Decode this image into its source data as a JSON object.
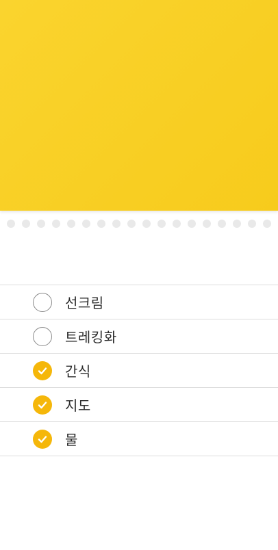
{
  "colors": {
    "header": "#f8cf24",
    "accent": "#f5b70a",
    "divider": "#dcdcdc",
    "perforation_dot": "#e9e9e9"
  },
  "checklist": {
    "items": [
      {
        "label": "선크림",
        "checked": false
      },
      {
        "label": "트레킹화",
        "checked": false
      },
      {
        "label": "간식",
        "checked": true
      },
      {
        "label": "지도",
        "checked": true
      },
      {
        "label": "물",
        "checked": true
      }
    ]
  }
}
